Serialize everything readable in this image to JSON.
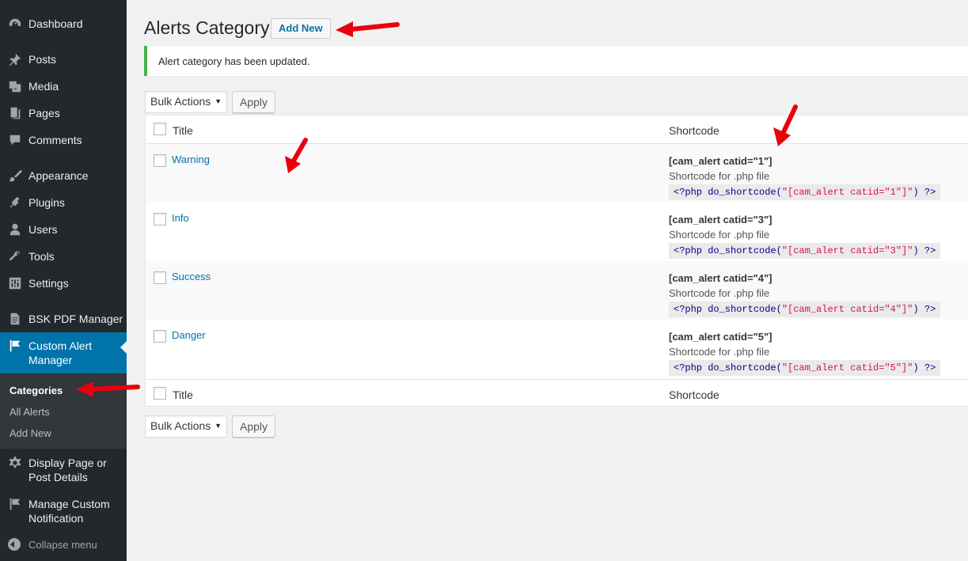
{
  "sidebar": {
    "items": [
      {
        "label": "Dashboard",
        "icon": "dashboard-icon"
      },
      {
        "label": "Posts",
        "icon": "pin-icon"
      },
      {
        "label": "Media",
        "icon": "media-icon"
      },
      {
        "label": "Pages",
        "icon": "pages-icon"
      },
      {
        "label": "Comments",
        "icon": "comment-icon"
      },
      {
        "label": "Appearance",
        "icon": "brush-icon"
      },
      {
        "label": "Plugins",
        "icon": "plug-icon"
      },
      {
        "label": "Users",
        "icon": "user-icon"
      },
      {
        "label": "Tools",
        "icon": "wrench-icon"
      },
      {
        "label": "Settings",
        "icon": "sliders-icon"
      },
      {
        "label": "BSK PDF Manager",
        "icon": "document-icon"
      },
      {
        "label": "Custom Alert Manager",
        "icon": "flag-icon"
      },
      {
        "label": "Display Page or Post Details",
        "icon": "gear-icon"
      },
      {
        "label": "Manage Custom Notification",
        "icon": "flag-icon"
      }
    ],
    "submenu": [
      "Categories",
      "All Alerts",
      "Add New"
    ],
    "collapse_label": "Collapse menu",
    "accent_color": "#0073aa"
  },
  "page": {
    "title": "Alerts Category",
    "add_new_label": "Add New",
    "notice": "Alert category has been updated.",
    "bulk_actions_label": "Bulk Actions",
    "apply_label": "Apply"
  },
  "table": {
    "headers": {
      "title": "Title",
      "shortcode": "Shortcode"
    },
    "rows": [
      {
        "title": "Warning",
        "shortcode": "[cam_alert catid=\"1\"]",
        "note": "Shortcode for .php file",
        "code_open": "<?php do_shortcode(",
        "code_str": "\"[cam_alert catid=\"1\"]\"",
        "code_close": ") ?>"
      },
      {
        "title": "Info",
        "shortcode": "[cam_alert catid=\"3\"]",
        "note": "Shortcode for .php file",
        "code_open": "<?php do_shortcode(",
        "code_str": "\"[cam_alert catid=\"3\"]\"",
        "code_close": ") ?>"
      },
      {
        "title": "Success",
        "shortcode": "[cam_alert catid=\"4\"]",
        "note": "Shortcode for .php file",
        "code_open": "<?php do_shortcode(",
        "code_str": "\"[cam_alert catid=\"4\"]\"",
        "code_close": ") ?>"
      },
      {
        "title": "Danger",
        "shortcode": "[cam_alert catid=\"5\"]",
        "note": "Shortcode for .php file",
        "code_open": "<?php do_shortcode(",
        "code_str": "\"[cam_alert catid=\"5\"]\"",
        "code_close": ") ?>"
      }
    ]
  },
  "annotation_color": "#e8000b"
}
